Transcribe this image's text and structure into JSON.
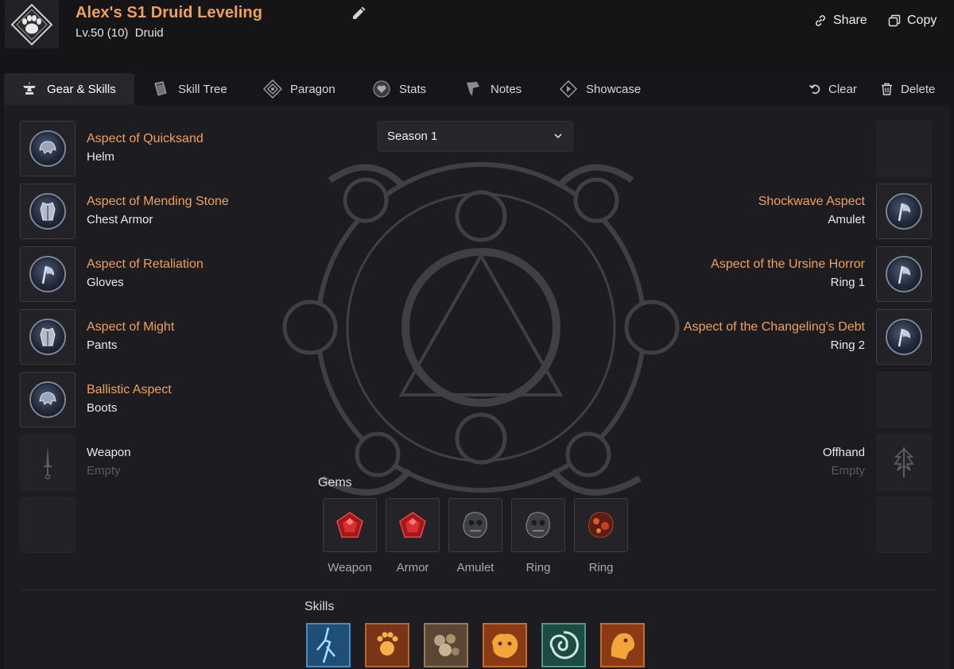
{
  "header": {
    "title": "Alex's S1 Druid Leveling",
    "level": "Lv.50 (10)",
    "class_name": "Druid",
    "share_label": "Share",
    "copy_label": "Copy"
  },
  "tabs": [
    {
      "label": "Gear & Skills",
      "icon": "anvil-icon",
      "active": true
    },
    {
      "label": "Skill Tree",
      "icon": "book-icon",
      "active": false
    },
    {
      "label": "Paragon",
      "icon": "paragon-board-icon",
      "active": false
    },
    {
      "label": "Stats",
      "icon": "heart-stats-icon",
      "active": false
    },
    {
      "label": "Notes",
      "icon": "scroll-icon",
      "active": false
    },
    {
      "label": "Showcase",
      "icon": "play-diamond-icon",
      "active": false
    }
  ],
  "actions": {
    "clear_label": "Clear",
    "delete_label": "Delete"
  },
  "season": {
    "selected": "Season 1"
  },
  "gear_left": [
    {
      "aspect": "Aspect of Quicksand",
      "slot": "Helm",
      "icon": "helm-orb-icon"
    },
    {
      "aspect": "Aspect of Mending Stone",
      "slot": "Chest Armor",
      "icon": "chest-orb-icon"
    },
    {
      "aspect": "Aspect of Retaliation",
      "slot": "Gloves",
      "icon": "axe-orb-icon"
    },
    {
      "aspect": "Aspect of Might",
      "slot": "Pants",
      "icon": "chest-orb-icon"
    },
    {
      "aspect": "Ballistic Aspect",
      "slot": "Boots",
      "icon": "helm-orb-icon"
    }
  ],
  "weapon": {
    "slot": "Weapon",
    "state": "Empty"
  },
  "gear_right": [
    {
      "aspect": "Shockwave Aspect",
      "slot": "Amulet",
      "icon": "axe-orb-icon"
    },
    {
      "aspect": "Aspect of the Ursine Horror",
      "slot": "Ring 1",
      "icon": "axe-orb-icon"
    },
    {
      "aspect": "Aspect of the Changeling's Debt",
      "slot": "Ring 2",
      "icon": "axe-orb-icon"
    }
  ],
  "offhand": {
    "slot": "Offhand",
    "state": "Empty"
  },
  "gems": {
    "title": "Gems",
    "items": [
      {
        "label": "Weapon",
        "icon": "ruby-gem-icon"
      },
      {
        "label": "Armor",
        "icon": "ruby-gem-icon"
      },
      {
        "label": "Amulet",
        "icon": "skull-gem-icon"
      },
      {
        "label": "Ring",
        "icon": "skull-gem-icon"
      },
      {
        "label": "Ring",
        "icon": "amber-gem-icon"
      }
    ]
  },
  "skills": {
    "title": "Skills",
    "items": [
      {
        "icon": "lightning-skill-icon"
      },
      {
        "icon": "paw-sun-skill-icon"
      },
      {
        "icon": "boulder-skill-icon"
      },
      {
        "icon": "werebear-skill-icon"
      },
      {
        "icon": "vortex-skill-icon"
      },
      {
        "icon": "lion-skill-icon"
      }
    ]
  }
}
